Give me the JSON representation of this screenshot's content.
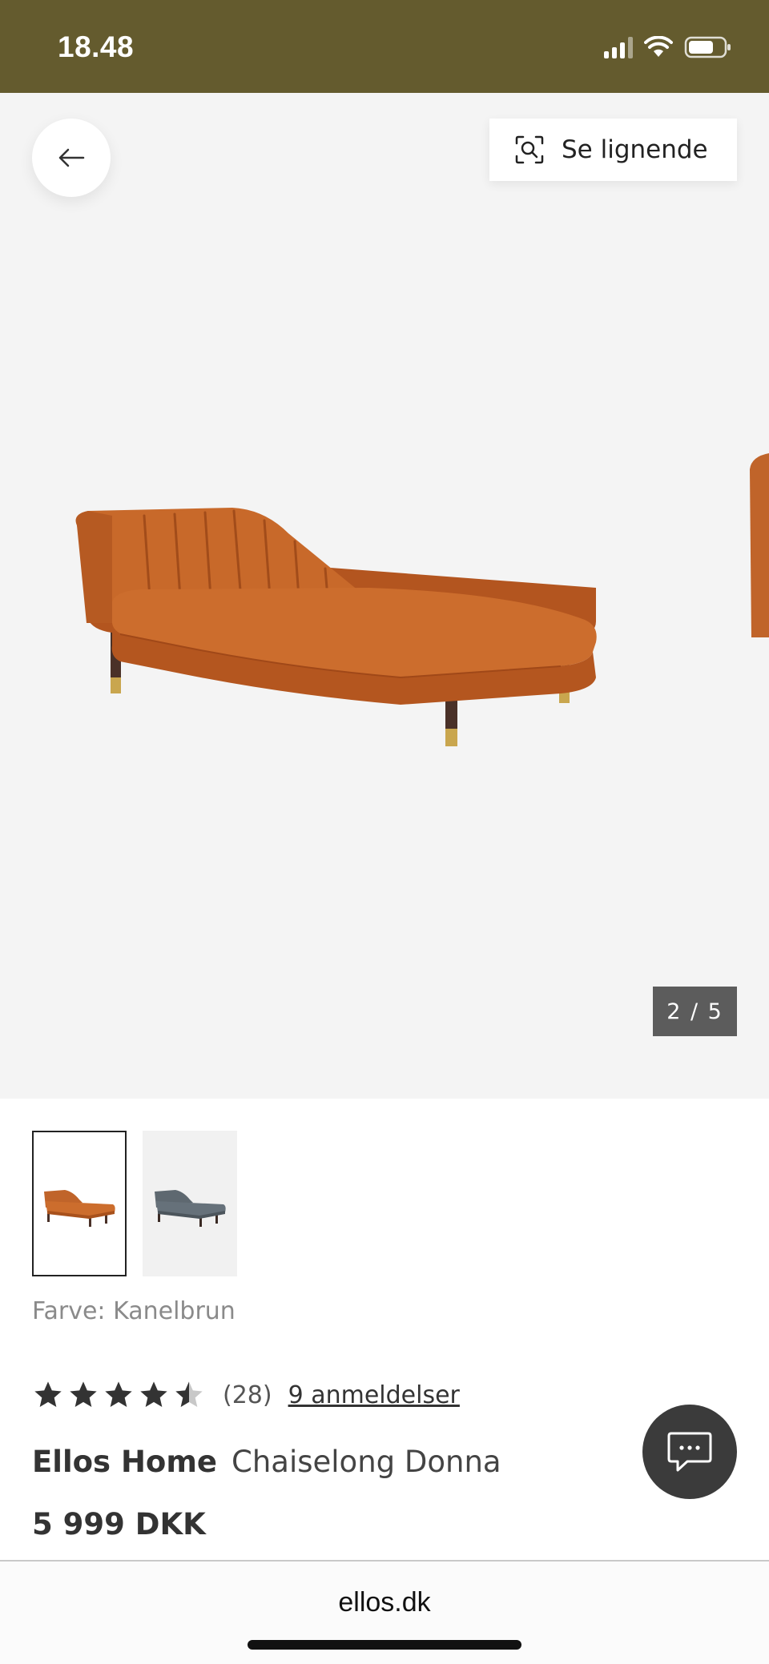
{
  "status_bar": {
    "time": "18.48",
    "icons": [
      "signal-icon",
      "wifi-icon",
      "battery-icon"
    ],
    "background": "#645b2e"
  },
  "gallery": {
    "similar_label": "Se lignende",
    "counter": "2 / 5",
    "background": "#f4f4f4"
  },
  "product": {
    "color_label": "Farve: Kanelbrun",
    "rating_count": "(28)",
    "reviews_link": "9 anmeldelser",
    "rating_value": 4.5,
    "rating_max": 5,
    "brand": "Ellos Home",
    "name": "Chaiselong Donna",
    "price": "5 999 DKK",
    "thumbnails": [
      {
        "color": "#c0642a",
        "selected": true
      },
      {
        "color": "#5e6870",
        "selected": false
      }
    ]
  },
  "browser": {
    "url": "ellos.dk"
  },
  "colors": {
    "accent_sofa": "#c0642a",
    "chat_button": "#3b3b3b"
  }
}
